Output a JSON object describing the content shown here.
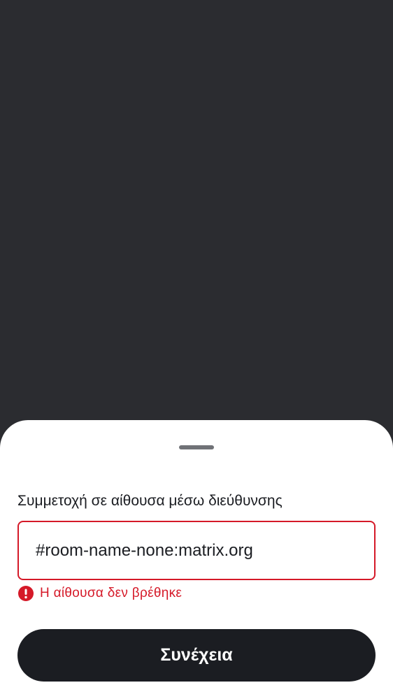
{
  "bottom_sheet": {
    "field_label": "Συμμετοχή σε αίθουσα μέσω διεύθυνσης",
    "address_input": {
      "value": "#room-name-none:matrix.org"
    },
    "error": {
      "icon": "error-icon",
      "message": "Η αίθουσα δεν βρέθηκε"
    },
    "continue_label": "Συνέχεια"
  },
  "colors": {
    "scrim": "#2b2c30",
    "sheet_background": "#ffffff",
    "error": "#d51928",
    "primary_button": "#1b1d22",
    "text_primary": "#1b1d22"
  }
}
